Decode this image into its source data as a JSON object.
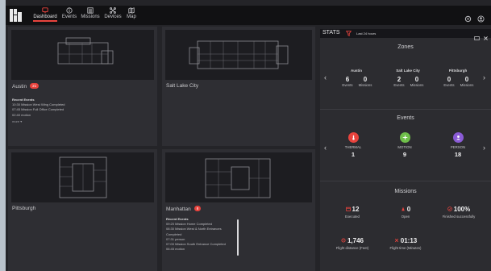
{
  "nav": {
    "items": [
      {
        "label": "Dashboard",
        "icon": "dashboard-icon",
        "active": true
      },
      {
        "label": "Events",
        "icon": "info-icon"
      },
      {
        "label": "Missions",
        "icon": "list-icon"
      },
      {
        "label": "Devices",
        "icon": "drone-icon"
      },
      {
        "label": "Map",
        "icon": "map-icon"
      }
    ]
  },
  "sites": {
    "austin": {
      "name": "Austin",
      "badge": "21",
      "events_header": "Recent Events",
      "events": [
        {
          "time": "10:30",
          "text": "Mission West Wing Completed"
        },
        {
          "time": "07:45",
          "text": "Mission Full Office Completed"
        },
        {
          "time": "02:40",
          "text": "motion"
        }
      ],
      "more": "more",
      "more_arrow": "▾"
    },
    "slc": {
      "name": "Salt Lake City"
    },
    "pittsburgh": {
      "name": "Pittsburgh"
    },
    "manhattan": {
      "name": "Manhattan",
      "badge": "8",
      "events_header": "Recent Events",
      "events": [
        {
          "time": "09:20",
          "text": "Mission Home Completed"
        },
        {
          "time": "08:30",
          "text": "Mission West & North Entrances"
        },
        {
          "time": "",
          "text": "Completed"
        },
        {
          "time": "07:31",
          "text": "person"
        },
        {
          "time": "07:00",
          "text": "Mission South Entrance Completed"
        },
        {
          "time": "06:45",
          "text": "motion"
        }
      ]
    }
  },
  "stats": {
    "title": "STATS",
    "range": "Last 24 hours",
    "zones": {
      "title": "Zones",
      "items": [
        {
          "name": "Austin",
          "events": "6",
          "missions": "0"
        },
        {
          "name": "Salt Lake City",
          "events": "2",
          "missions": "0"
        },
        {
          "name": "Pittsburgh",
          "events": "0",
          "missions": "0"
        }
      ],
      "events_label": "Events",
      "missions_label": "Missions"
    },
    "events": {
      "title": "Events",
      "items": [
        {
          "name": "THERMAL",
          "value": "1",
          "color": "#e8433d",
          "icon": "thermometer-icon"
        },
        {
          "name": "MOTION",
          "value": "9",
          "color": "#6fbf4a",
          "icon": "motion-icon"
        },
        {
          "name": "PERSON",
          "value": "18",
          "color": "#8a5bd6",
          "icon": "person-icon"
        }
      ]
    },
    "missions": {
      "title": "Missions",
      "executed": {
        "value": "12",
        "label": "Executed"
      },
      "open": {
        "value": "0",
        "label": "Open"
      },
      "success": {
        "value": "100%",
        "label": "Finished successfully"
      },
      "distance": {
        "value": "1,746",
        "label": "Flight distance (Feet)"
      },
      "time": {
        "value": "01:13",
        "label": "Flight time (Minutes)"
      }
    }
  },
  "colors": {
    "accent": "#e8433d",
    "background": "#242428",
    "nav": "#111113"
  }
}
